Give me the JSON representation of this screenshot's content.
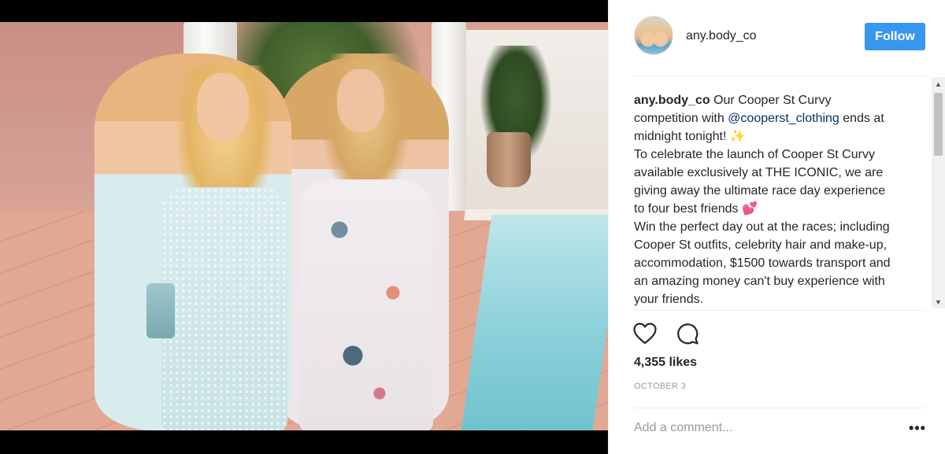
{
  "post": {
    "username": "any.body_co",
    "follow_label": "Follow",
    "caption": {
      "username": "any.body_co",
      "line1_text": " Our Cooper St Curvy competition with ",
      "mention": "@cooperst_clothing",
      "line1_tail": " ends at midnight tonight! ✨",
      "para2": "To celebrate the launch of Cooper St Curvy available exclusively at THE ICONIC, we are giving away the ultimate race day experience to four best friends 💕",
      "para3": "Win the perfect day out at the races; including Cooper St outfits, celebrity hair and make-up, accommodation, $1500 towards transport and an amazing money can't buy experience with your friends."
    },
    "likes": "4,355 likes",
    "date": "OCTOBER 3",
    "comment_placeholder": "Add a comment...",
    "more_label": "•••"
  },
  "icons": {
    "like": "heart-outline-icon",
    "comment": "speech-bubble-icon",
    "scroll_up": "▲",
    "scroll_down": "▼"
  },
  "colors": {
    "follow_button": "#3897f0",
    "mention": "#003569",
    "muted": "#999999"
  }
}
